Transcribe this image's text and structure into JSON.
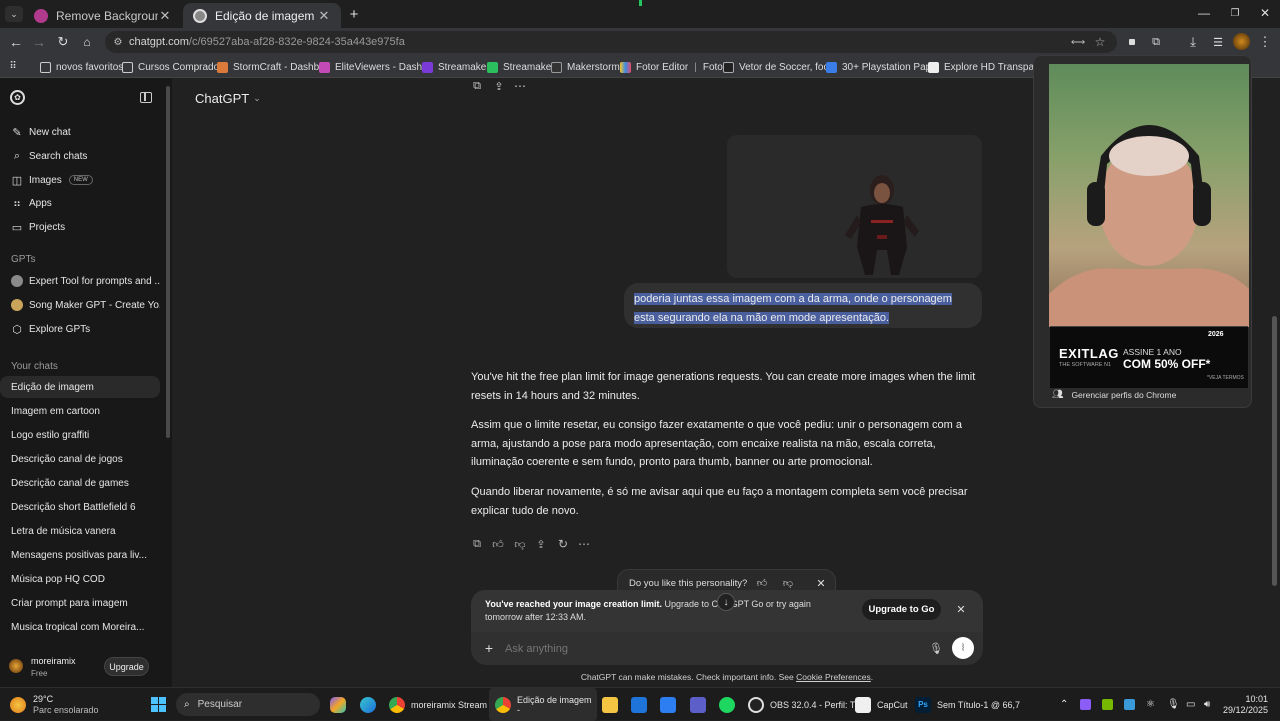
{
  "browser": {
    "tabs": [
      {
        "title": "Remove Background From Pho",
        "active": false
      },
      {
        "title": "Edição de imagem",
        "active": true
      }
    ],
    "url_host": "chatgpt.com",
    "url_path": "/c/69527aba-af28-832e-9824-35a443e975fa",
    "bookmarks": [
      "novos favoritos",
      "Cursos Comprados",
      "StormCraft - Dashb...",
      "EliteViewers - Dash...",
      "Streamaker",
      "Streamaker",
      "Makerstorm",
      "Fotor Editor",
      "Foto...",
      "Vetor de Soccer, foo...",
      "30+ Playstation Pap...",
      "Explore HD Transpa..."
    ]
  },
  "profile_popup": {
    "label": "Gerenciar perfis do Chrome"
  },
  "ad": {
    "brand": "EXITLAG",
    "sub": "THE SOFTWARE N1",
    "line1": "ASSINE 1 ANO",
    "line2": "COM 50% OFF*",
    "year": "2026",
    "fine": "*VEJA TERMOS"
  },
  "sidebar": {
    "nav": [
      {
        "label": "New chat",
        "icon": "pencil-icon"
      },
      {
        "label": "Search chats",
        "icon": "search-icon"
      },
      {
        "label": "Images",
        "icon": "images-icon",
        "badge": "NEW"
      },
      {
        "label": "Apps",
        "icon": "apps-icon"
      },
      {
        "label": "Projects",
        "icon": "folder-icon"
      }
    ],
    "gpts_heading": "GPTs",
    "gpts": [
      {
        "label": "Expert Tool for prompts and ..."
      },
      {
        "label": "Song Maker GPT - Create Yo..."
      },
      {
        "label": "Explore GPTs"
      }
    ],
    "chats_heading": "Your chats",
    "chats": [
      "Edição de imagem",
      "Imagem em cartoon",
      "Logo estilo graffiti",
      "Descrição canal de jogos",
      "Descrição canal de games",
      "Descrição short Battlefield 6",
      "Letra de música vanera",
      "Mensagens positivas para liv...",
      "Música pop HQ COD",
      "Criar prompt para imagem",
      "Musica tropical com Moreira..."
    ],
    "user": {
      "name": "moreiramix",
      "plan": "Free",
      "upgrade": "Upgrade"
    }
  },
  "header": {
    "model": "ChatGPT"
  },
  "conversation": {
    "user_message": "poderia juntas essa imagem com a da arma, onde o personagem esta segurando ela na mão em mode apresentação.",
    "assistant_p1": "You've hit the free plan limit for image generations requests. You can create more images when the limit resets in 14 hours and 32 minutes.",
    "assistant_p2": "Assim que o limite resetar, eu consigo fazer exatamente o que você pediu: unir o personagem com a arma, ajustando a pose para modo apresentação, com encaixe realista na mão, escala correta, iluminação coerente e sem fundo, pronto para thumb, banner ou arte promocional.",
    "assistant_p3": "Quando liberar novamente, é só me avisar aqui que eu faço a montagem completa sem você precisar explicar tudo de novo."
  },
  "personality": {
    "question": "Do you like this personality?"
  },
  "limit_banner": {
    "bold": "You've reached your image creation limit.",
    "rest": " Upgrade to ChatGPT Go or try again tomorrow after 12:33 AM.",
    "button": "Upgrade to Go"
  },
  "composer": {
    "placeholder": "Ask anything"
  },
  "footer": {
    "text": "ChatGPT can make mistakes. Check important info. See ",
    "link": "Cookie Preferences",
    "end": "."
  },
  "taskbar": {
    "weather_temp": "29°C",
    "weather_desc": "Parc ensolarado",
    "search": "Pesquisar",
    "apps": [
      {
        "label": "moreiramix Stream -"
      },
      {
        "label": "Edição de imagem -"
      },
      {
        "label": "OBS 32.0.4 - Perfil: T"
      },
      {
        "label": "CapCut"
      },
      {
        "label": "Sem Título-1 @ 66,7"
      }
    ],
    "time": "10:01",
    "date": "29/12/2025"
  },
  "colors": {
    "accent": "#2a4c8c",
    "selection": "#4a5f9e",
    "sidebar_bg": "#181818",
    "main_bg": "#212121"
  }
}
